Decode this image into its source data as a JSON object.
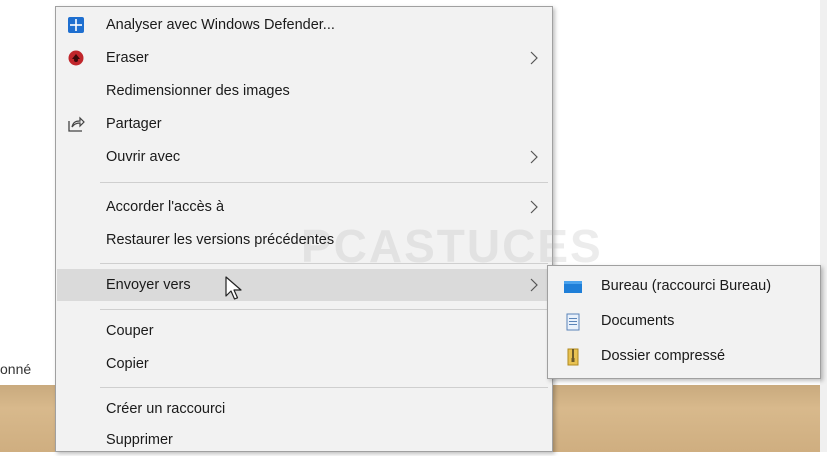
{
  "background": {
    "partial_text": "onné"
  },
  "context_menu": {
    "items": [
      {
        "label": "Analyser avec Windows Defender...",
        "icon": "windows-defender-icon",
        "submenu": false
      },
      {
        "label": "Eraser",
        "icon": "eraser-icon",
        "submenu": true
      },
      {
        "label": "Redimensionner des images",
        "icon": "",
        "submenu": false
      },
      {
        "label": "Partager",
        "icon": "share-icon",
        "submenu": false
      },
      {
        "label": "Ouvrir avec",
        "icon": "",
        "submenu": true
      },
      {
        "label": "Accorder l'accès à",
        "icon": "",
        "submenu": true
      },
      {
        "label": "Restaurer les versions précédentes",
        "icon": "",
        "submenu": false
      },
      {
        "label": "Envoyer vers",
        "icon": "",
        "submenu": true,
        "highlighted": true
      },
      {
        "label": "Couper",
        "icon": "",
        "submenu": false
      },
      {
        "label": "Copier",
        "icon": "",
        "submenu": false
      },
      {
        "label": "Créer un raccourci",
        "icon": "",
        "submenu": false
      },
      {
        "label": "Supprimer",
        "icon": "",
        "submenu": false
      }
    ]
  },
  "send_to_submenu": {
    "items": [
      {
        "label": "Bureau (raccourci Bureau)",
        "icon": "desktop-icon"
      },
      {
        "label": "Documents",
        "icon": "documents-icon"
      },
      {
        "label": "Dossier compressé",
        "icon": "zip-folder-icon"
      }
    ]
  },
  "watermark": "PCASTUCES",
  "colors": {
    "menu_bg": "#f2f2f2",
    "highlight": "#dadada",
    "defender_blue": "#1e6fd0",
    "eraser_red": "#c0262b"
  }
}
